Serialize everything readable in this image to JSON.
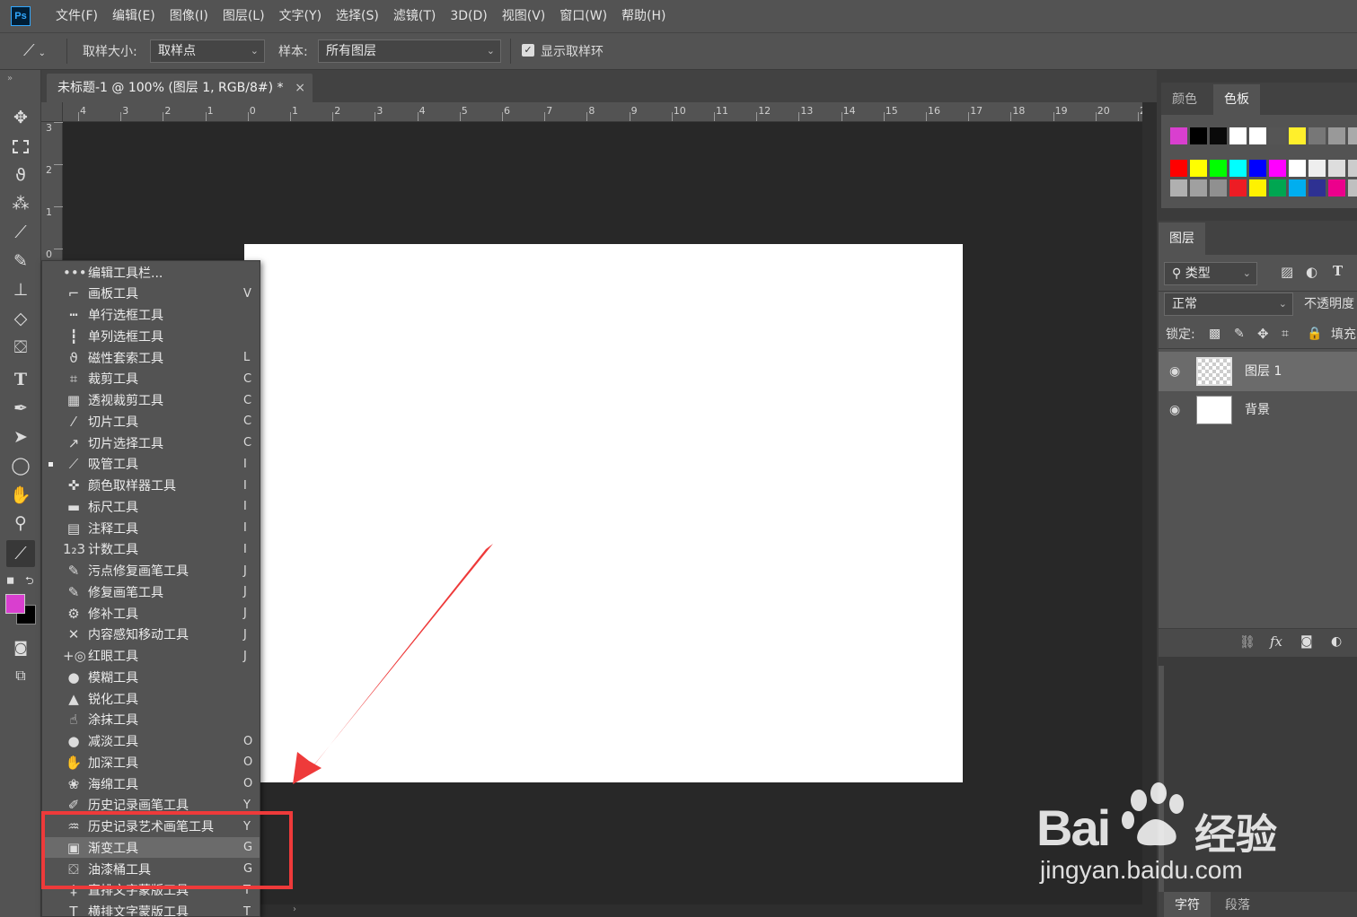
{
  "app": {
    "logo": "Ps"
  },
  "menu": [
    "文件(F)",
    "编辑(E)",
    "图像(I)",
    "图层(L)",
    "文字(Y)",
    "选择(S)",
    "滤镜(T)",
    "3D(D)",
    "视图(V)",
    "窗口(W)",
    "帮助(H)"
  ],
  "options": {
    "sample_size_label": "取样大小:",
    "sample_size_value": "取样点",
    "sample_label": "样本:",
    "sample_value": "所有图层",
    "show_ring_label": "显示取样环"
  },
  "document_tab": {
    "title": "未标题-1 @ 100% (图层 1, RGB/8#) *",
    "close": "×"
  },
  "ruler_top": [
    "4",
    "3",
    "2",
    "1",
    "0",
    "1",
    "2",
    "3",
    "4",
    "5",
    "6",
    "7",
    "8",
    "9",
    "10",
    "11",
    "12",
    "13",
    "14",
    "15",
    "16",
    "17",
    "18",
    "19",
    "20",
    "2"
  ],
  "ruler_left": [
    "3",
    "2",
    "1",
    "0"
  ],
  "panels": {
    "color_tab": "颜色",
    "swatches_tab": "色板",
    "layers_tab": "图层",
    "filter_type": "类型",
    "blend_mode": "正常",
    "opacity_label": "不透明度",
    "lock_label": "锁定:",
    "fill_label": "填充",
    "character_tab": "字符",
    "paragraph_tab": "段落",
    "fx_label": "fx"
  },
  "swatch_colors": {
    "row1": [
      "#d93fcf",
      "#000000",
      "#0a0a0a",
      "#ffffff",
      "#ffffff",
      "#555555",
      "#ffef2b",
      "#777777",
      "#999999",
      "#aaaaaa"
    ],
    "row2": [
      "#ff0000",
      "#ffff00",
      "#00ff00",
      "#00ffff",
      "#0000ff",
      "#ff00ff",
      "#ffffff",
      "#eeeeee",
      "#dddddd",
      "#cccccc"
    ],
    "row3": [
      "#b0b0b0",
      "#a0a0a0",
      "#909090",
      "#ed1c24",
      "#fff200",
      "#00a651",
      "#00aeef",
      "#2e3192",
      "#ec008c",
      "#c0c0c0"
    ]
  },
  "colors": {
    "foreground": "#d93fcf",
    "background": "#000000",
    "highlight_box": "#ee3a3a"
  },
  "layers": [
    {
      "name": "图层 1",
      "selected": true,
      "transparent": true
    },
    {
      "name": "背景",
      "selected": false,
      "transparent": false
    }
  ],
  "flyout": [
    {
      "icon": "•••",
      "label": "编辑工具栏...",
      "key": "",
      "hl": false,
      "current": false
    },
    {
      "icon": "⌐",
      "label": "画板工具",
      "key": "V",
      "hl": false,
      "current": false
    },
    {
      "icon": "┅",
      "label": "单行选框工具",
      "key": "",
      "hl": false,
      "current": false
    },
    {
      "icon": "┇",
      "label": "单列选框工具",
      "key": "",
      "hl": false,
      "current": false
    },
    {
      "icon": "ϑ",
      "label": "磁性套索工具",
      "key": "L",
      "hl": false,
      "current": false
    },
    {
      "icon": "⌗",
      "label": "裁剪工具",
      "key": "C",
      "hl": false,
      "current": false
    },
    {
      "icon": "▦",
      "label": "透视裁剪工具",
      "key": "C",
      "hl": false,
      "current": false
    },
    {
      "icon": "⁄",
      "label": "切片工具",
      "key": "C",
      "hl": false,
      "current": false
    },
    {
      "icon": "↗",
      "label": "切片选择工具",
      "key": "C",
      "hl": false,
      "current": false
    },
    {
      "icon": "⟋",
      "label": "吸管工具",
      "key": "I",
      "hl": false,
      "current": true
    },
    {
      "icon": "✜",
      "label": "颜色取样器工具",
      "key": "I",
      "hl": false,
      "current": false
    },
    {
      "icon": "▬",
      "label": "标尺工具",
      "key": "I",
      "hl": false,
      "current": false
    },
    {
      "icon": "▤",
      "label": "注释工具",
      "key": "I",
      "hl": false,
      "current": false
    },
    {
      "icon": "1₂3",
      "label": "计数工具",
      "key": "I",
      "hl": false,
      "current": false
    },
    {
      "icon": "✎",
      "label": "污点修复画笔工具",
      "key": "J",
      "hl": false,
      "current": false
    },
    {
      "icon": "✎",
      "label": "修复画笔工具",
      "key": "J",
      "hl": false,
      "current": false
    },
    {
      "icon": "⚙",
      "label": "修补工具",
      "key": "J",
      "hl": false,
      "current": false
    },
    {
      "icon": "✕",
      "label": "内容感知移动工具",
      "key": "J",
      "hl": false,
      "current": false
    },
    {
      "icon": "+◎",
      "label": "红眼工具",
      "key": "J",
      "hl": false,
      "current": false
    },
    {
      "icon": "●",
      "label": "模糊工具",
      "key": "",
      "hl": false,
      "current": false
    },
    {
      "icon": "▲",
      "label": "锐化工具",
      "key": "",
      "hl": false,
      "current": false
    },
    {
      "icon": "☝",
      "label": "涂抹工具",
      "key": "",
      "hl": false,
      "current": false
    },
    {
      "icon": "●",
      "label": "减淡工具",
      "key": "O",
      "hl": false,
      "current": false
    },
    {
      "icon": "✋",
      "label": "加深工具",
      "key": "O",
      "hl": false,
      "current": false
    },
    {
      "icon": "❀",
      "label": "海绵工具",
      "key": "O",
      "hl": false,
      "current": false
    },
    {
      "icon": "✐",
      "label": "历史记录画笔工具",
      "key": "Y",
      "hl": false,
      "current": false
    },
    {
      "icon": "♒",
      "label": "历史记录艺术画笔工具",
      "key": "Y",
      "hl": false,
      "current": false
    },
    {
      "icon": "▣",
      "label": "渐变工具",
      "key": "G",
      "hl": true,
      "current": false
    },
    {
      "icon": "⛋",
      "label": "油漆桶工具",
      "key": "G",
      "hl": false,
      "current": false
    },
    {
      "icon": "‡",
      "label": "直排文字蒙版工具",
      "key": "T",
      "hl": false,
      "current": false
    },
    {
      "icon": "T",
      "label": "横排文字蒙版工具",
      "key": "T",
      "hl": false,
      "current": false
    }
  ],
  "watermark": {
    "brand": "Bai",
    "brand2": "经验",
    "url": "jingyan.baidu.com"
  }
}
